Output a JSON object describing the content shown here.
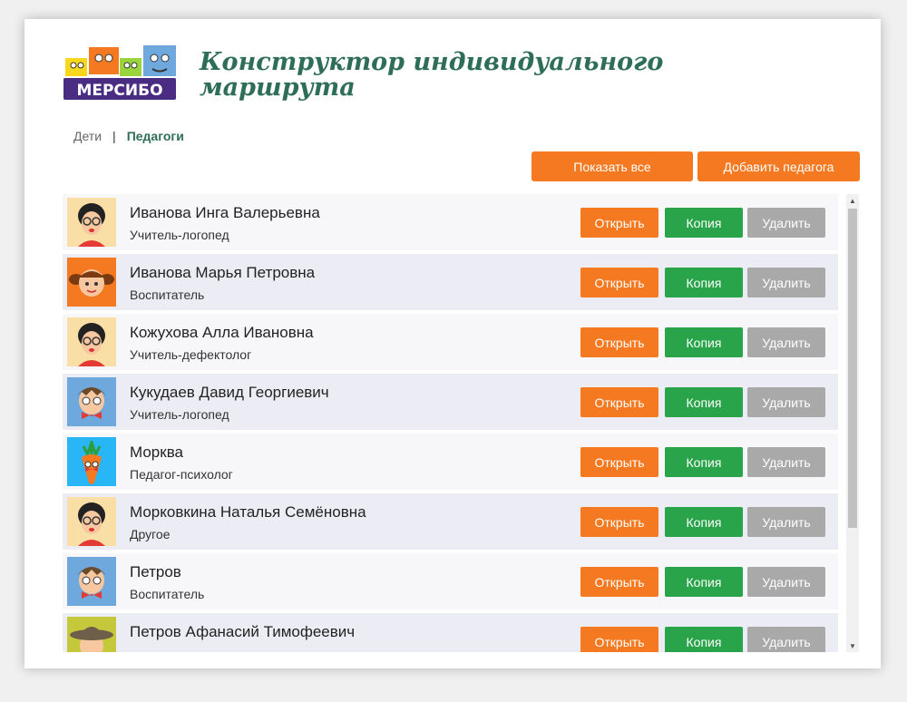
{
  "header": {
    "logo_text": "МЕРСИБО",
    "title": "Конструктор индивидуального маршрута"
  },
  "nav": {
    "children": "Дети",
    "separator": "|",
    "teachers": "Педагоги"
  },
  "toolbar": {
    "show_all": "Показать все",
    "add_teacher": "Добавить педагога"
  },
  "row_buttons": {
    "open": "Открыть",
    "copy": "Копия",
    "delete": "Удалить"
  },
  "teachers": [
    {
      "name": "Иванова Инга Валерьевна",
      "role": "Учитель-логопед",
      "avatar": "woman-glasses"
    },
    {
      "name": "Иванова Марья Петровна",
      "role": "Воспитатель",
      "avatar": "girl-pigtails"
    },
    {
      "name": "Кожухова Алла Ивановна",
      "role": "Учитель-дефектолог",
      "avatar": "woman-glasses"
    },
    {
      "name": "Кукудаев Давид Георгиевич",
      "role": "Учитель-логопед",
      "avatar": "man-bowtie"
    },
    {
      "name": "Морква",
      "role": "Педагог-психолог",
      "avatar": "carrot"
    },
    {
      "name": "Морковкина Наталья Семёновна",
      "role": "Другое",
      "avatar": "woman-glasses"
    },
    {
      "name": "Петров",
      "role": "Воспитатель",
      "avatar": "man-bowtie"
    },
    {
      "name": "Петров Афанасий Тимофеевич",
      "role": "",
      "avatar": "man-hat"
    }
  ]
}
